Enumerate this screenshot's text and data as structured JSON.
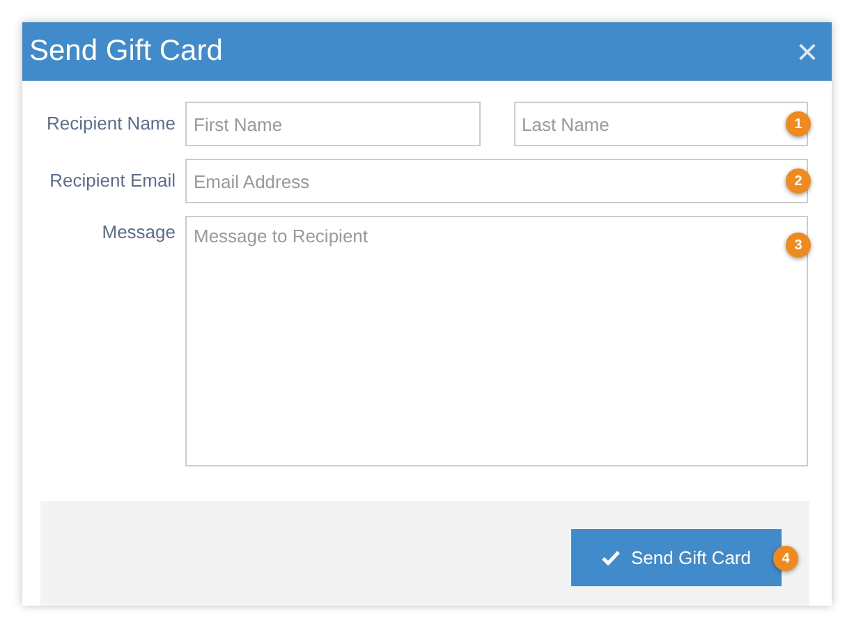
{
  "window": {
    "title": "Send Gift Card",
    "close": "×"
  },
  "fields": [
    {
      "kind": "line",
      "label": "Recipient Name",
      "inputs": [
        {
          "placeholder": "First Name"
        },
        {
          "placeholder": "Last Name"
        }
      ],
      "badge": "1"
    },
    {
      "kind": "line",
      "label": "Recipient Email",
      "inputs": [
        {
          "placeholder": "Email Address"
        }
      ],
      "badge": "2"
    },
    {
      "kind": "textarea",
      "label": "Message",
      "inputs": [
        {
          "placeholder": "Message to Recipient"
        }
      ],
      "badge": "3"
    }
  ],
  "submit": {
    "label": "Send Gift Card",
    "badge": "4"
  }
}
